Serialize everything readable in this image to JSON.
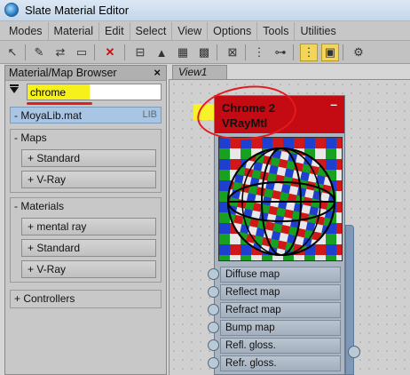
{
  "window": {
    "title": "Slate Material Editor"
  },
  "menubar": {
    "items": [
      "Modes",
      "Material",
      "Edit",
      "Select",
      "View",
      "Options",
      "Tools",
      "Utilities"
    ]
  },
  "toolbar": {
    "buttons": [
      {
        "icon": "select-pointer-icon"
      },
      {
        "icon": "eyedropper-icon"
      },
      {
        "icon": "put-to-scene-icon"
      },
      {
        "icon": "delete-x-icon"
      },
      {
        "icon": "assign-to-selection-icon"
      },
      {
        "icon": "make-unique-icon"
      },
      {
        "icon": "checker-background-icon"
      },
      {
        "icon": "checker-alt-icon"
      },
      {
        "icon": "layout-icon"
      },
      {
        "icon": "layout-children-icon"
      },
      {
        "icon": "move-children-icon"
      },
      {
        "icon": "hide-unused-slots-icon"
      },
      {
        "icon": "show-map-in-viewport-icon"
      },
      {
        "icon": "material-id-icon"
      }
    ],
    "accent": "#f3d55a"
  },
  "browser": {
    "title": "Material/Map Browser",
    "close": "×",
    "search": {
      "value": "chrome"
    },
    "library": {
      "name": "- MoyaLib.mat",
      "tag": "LIB"
    },
    "groups": [
      {
        "label": "- Maps",
        "items": [
          "+ Standard",
          "+ V-Ray"
        ]
      },
      {
        "label": "- Materials",
        "items": [
          "+ mental ray",
          "+ Standard",
          "+ V-Ray"
        ]
      }
    ],
    "controllers": "+ Controllers"
  },
  "view": {
    "tab": "View1"
  },
  "node": {
    "title": "Chrome 2",
    "subtitle": "VRayMtl",
    "minimize": "–",
    "header_color": "#c40a12",
    "slots": [
      "Diffuse map",
      "Reflect map",
      "Refract map",
      "Bump map",
      "Refl. gloss.",
      "Refr. gloss."
    ]
  }
}
